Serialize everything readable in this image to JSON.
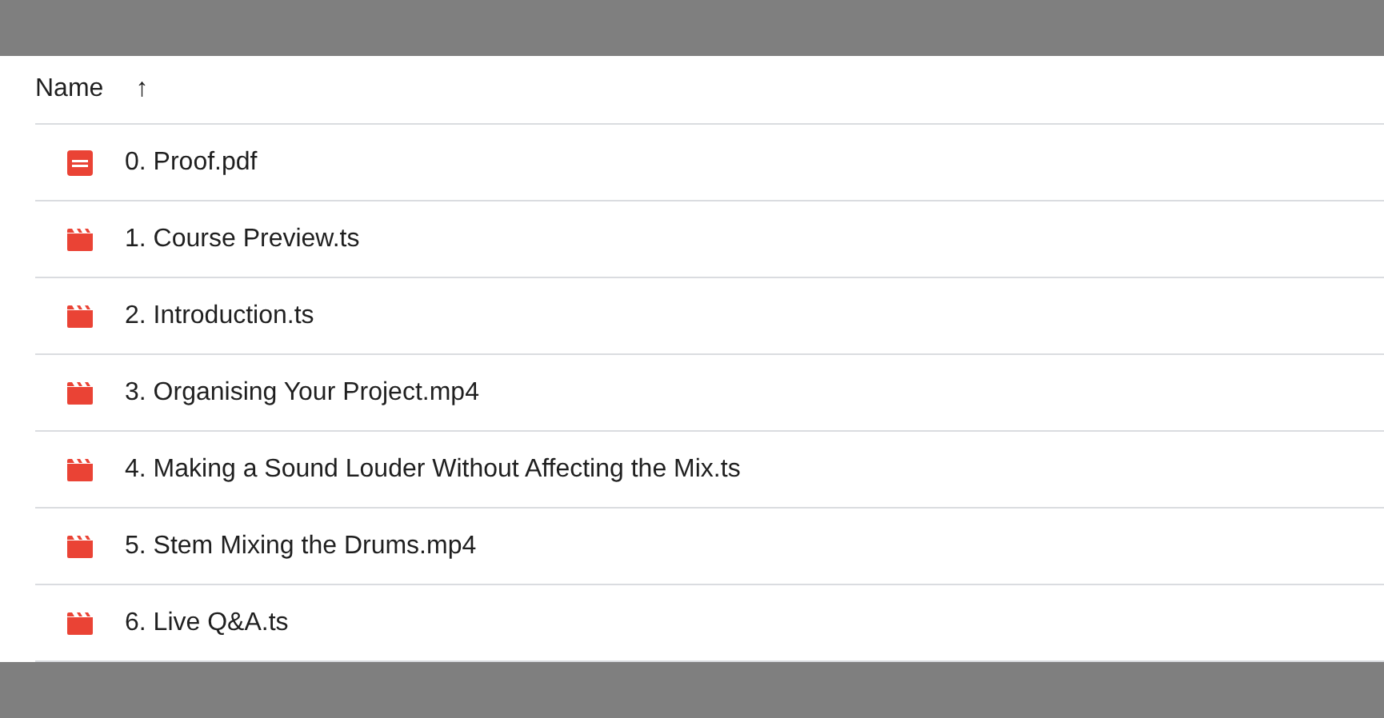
{
  "header": {
    "name_column": "Name",
    "sort_arrow": "↑"
  },
  "files": [
    {
      "name": "0. Proof.pdf",
      "kind": "pdf"
    },
    {
      "name": "1. Course Preview.ts",
      "kind": "video"
    },
    {
      "name": "2. Introduction.ts",
      "kind": "video"
    },
    {
      "name": "3. Organising Your Project.mp4",
      "kind": "video"
    },
    {
      "name": "4. Making a Sound Louder Without Affecting the Mix.ts",
      "kind": "video"
    },
    {
      "name": "5. Stem Mixing the Drums.mp4",
      "kind": "video"
    },
    {
      "name": "6. Live Q&A.ts",
      "kind": "video"
    }
  ]
}
